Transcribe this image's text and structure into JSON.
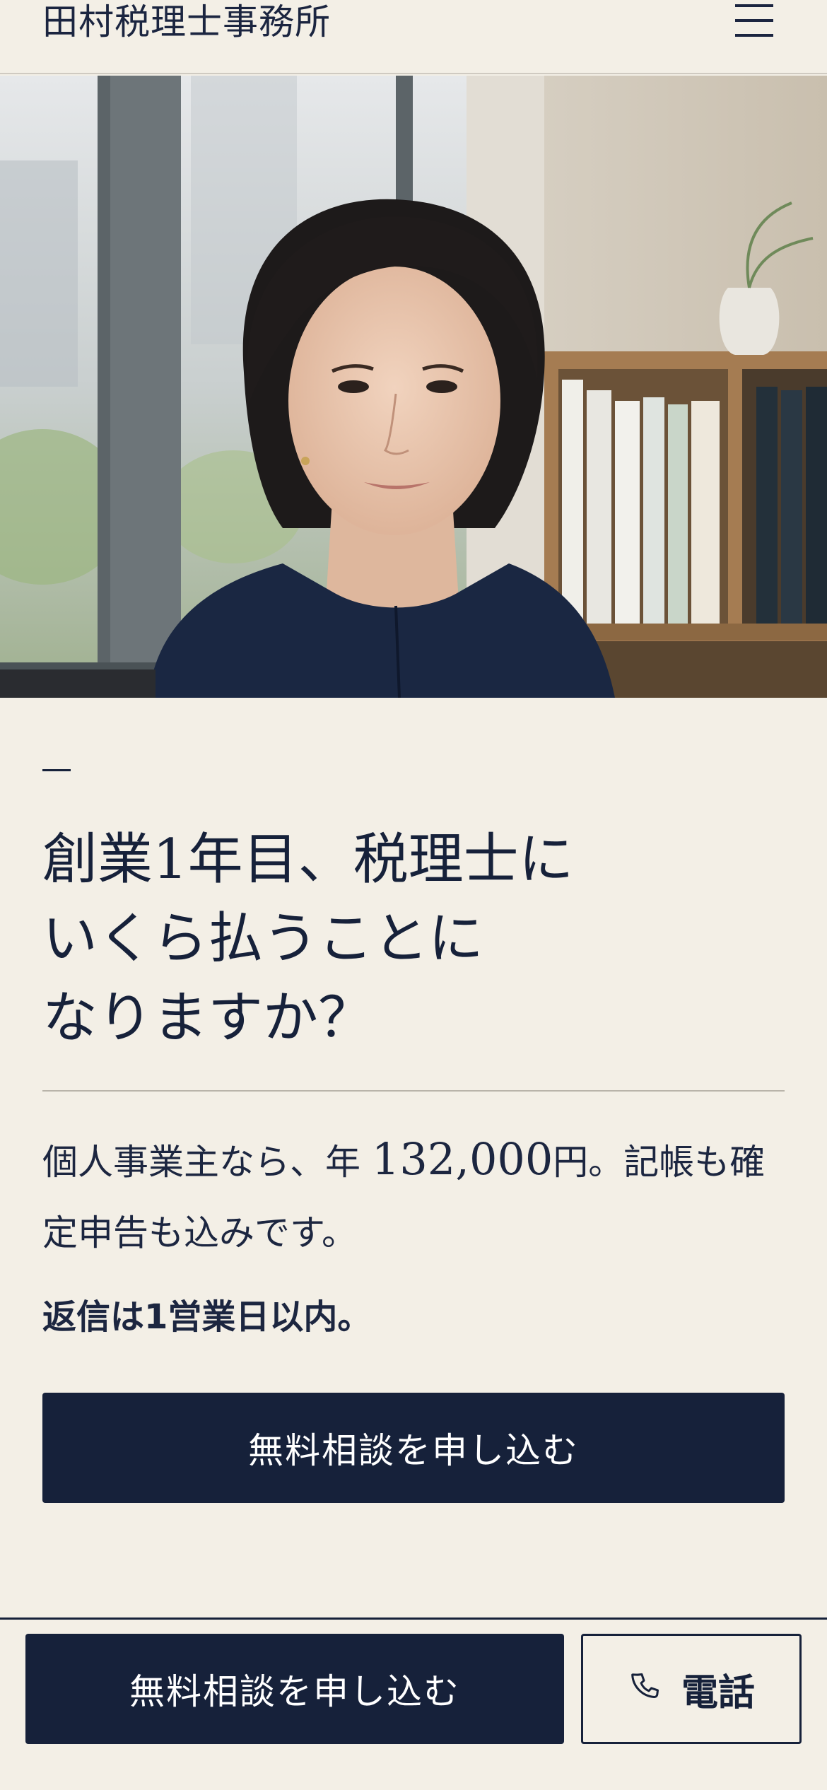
{
  "header": {
    "brand": "田村税理士事務所",
    "menu_icon": "hamburger-menu-icon"
  },
  "hero": {
    "image_description_icon": "portrait-photo"
  },
  "main": {
    "dash": "—",
    "headline_lines": [
      "創業1年目、税理士に",
      "いくら払うことに",
      "なりますか？"
    ],
    "body_prefix": "個人事業主なら、年 ",
    "body_price": "132,000",
    "body_suffix": "円。記帳も確定申告も込みです。",
    "reply_note": "返信は1営業日以内。",
    "cta_label": "無料相談を申し込む"
  },
  "bottom_bar": {
    "cta_label": "無料相談を申し込む",
    "call_label": "電話",
    "call_icon": "phone-icon"
  },
  "colors": {
    "background": "#f3efe6",
    "navy": "#16213a"
  }
}
